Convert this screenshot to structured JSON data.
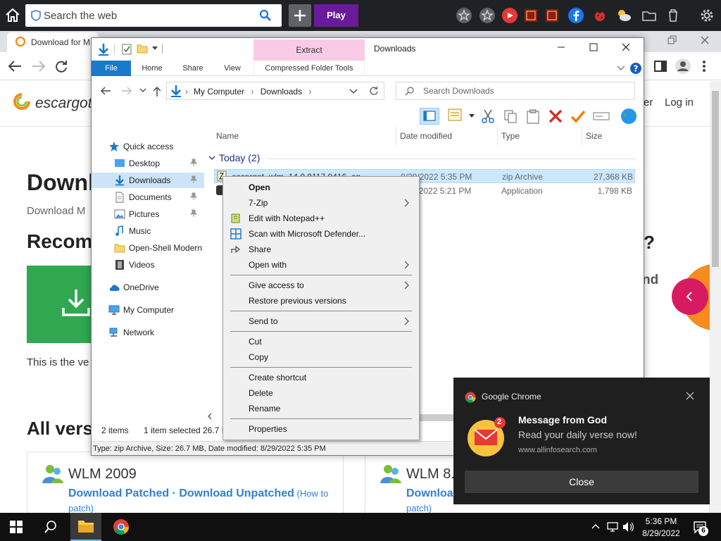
{
  "topbar": {
    "search_placeholder": "Search the web",
    "play_label": "Play"
  },
  "chrome": {
    "tab_title": "Download for M"
  },
  "page": {
    "logo": "escargot",
    "nav_login": "Log in",
    "nav_trunc": "er",
    "heading": "Downl",
    "subheading": "Download M",
    "recommended": "Recomm",
    "question_mark": "?",
    "and_text": "nd",
    "this_text": "This is the ve",
    "all_versions": "All vers",
    "cards": [
      {
        "title": "WLM 2009",
        "link1": "Download Patched",
        "sep": " · ",
        "link2": "Download Unpatched",
        "how": " (How to",
        "patch": "patch)"
      },
      {
        "title": "WLM 8.",
        "link1": "Downloa",
        "patch": "patch)"
      }
    ]
  },
  "explorer": {
    "contextual_tab_header": "Extract",
    "title": "Downloads",
    "tabs": {
      "file": "File",
      "home": "Home",
      "share": "Share",
      "view": "View",
      "cft": "Compressed Folder Tools"
    },
    "address": {
      "root": "My Computer",
      "sep": "›",
      "folder": "Downloads"
    },
    "search_placeholder": "Search Downloads",
    "nav": {
      "quick_access": "Quick access",
      "desktop": "Desktop",
      "downloads": "Downloads",
      "documents": "Documents",
      "pictures": "Pictures",
      "music": "Music",
      "open_shell": "Open-Shell Modern",
      "videos": "Videos",
      "onedrive": "OneDrive",
      "my_computer": "My Computer",
      "network": "Network"
    },
    "columns": {
      "name": "Name",
      "date": "Date modified",
      "type": "Type",
      "size": "Size"
    },
    "group": "Today (2)",
    "files": [
      {
        "name": "escargot_wlm_14.0.8117.0416_en",
        "date": "8/29/2022 5:35 PM",
        "type": "zip Archive",
        "size": "27,368 KB"
      },
      {
        "name": "",
        "date": "8/29/2022 5:21 PM",
        "type": "Application",
        "size": "1,798 KB"
      }
    ],
    "status": {
      "items": "2 items",
      "selected": "1 item selected",
      "size": "26.7 M"
    },
    "details": "Type: zip Archive, Size: 26.7 MB, Date modified: 8/29/2022 5:35 PM"
  },
  "context_menu": {
    "open": "Open",
    "zip7": "7-Zip",
    "notepad": "Edit with Notepad++",
    "defender": "Scan with Microsoft Defender...",
    "share": "Share",
    "open_with": "Open with",
    "give_access": "Give access to",
    "restore": "Restore previous versions",
    "send_to": "Send to",
    "cut": "Cut",
    "copy": "Copy",
    "create_shortcut": "Create shortcut",
    "delete": "Delete",
    "rename": "Rename",
    "properties": "Properties"
  },
  "notification": {
    "app": "Google Chrome",
    "title": "Message from God",
    "message": "Read your daily verse now!",
    "source": "www.allinfosearch.com",
    "badge": "2",
    "close_label": "Close"
  },
  "taskbar": {
    "time": "5:36 PM",
    "date": "8/29/2022",
    "notif_count": "6"
  },
  "colors": {
    "accent": "#1979ca",
    "context_tab": "#f9cbe7",
    "play": "#6a1b9a",
    "selection": "#cce8ff"
  }
}
